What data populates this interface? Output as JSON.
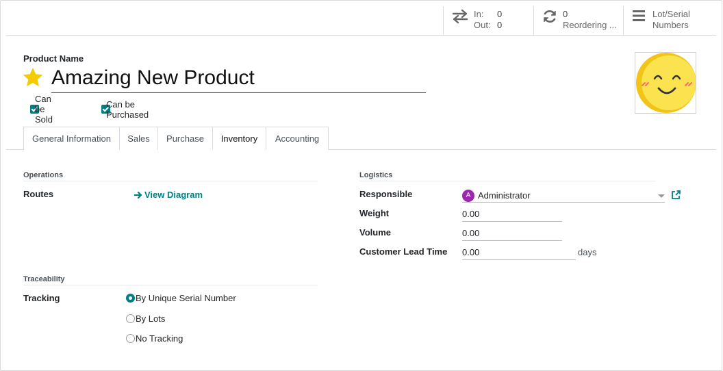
{
  "stats": {
    "in_label": "In:",
    "in_value": "0",
    "out_label": "Out:",
    "out_value": "0",
    "reorder_value": "0",
    "reorder_label": "Reordering ...",
    "lots_label_1": "Lot/Serial",
    "lots_label_2": "Numbers"
  },
  "product": {
    "name_label": "Product Name",
    "name": "Amazing New Product",
    "can_be_sold": "Can be Sold",
    "can_be_purchased": "Can be Purchased"
  },
  "tabs": [
    {
      "label": "General Information"
    },
    {
      "label": "Sales"
    },
    {
      "label": "Purchase"
    },
    {
      "label": "Inventory"
    },
    {
      "label": "Accounting"
    }
  ],
  "operations": {
    "title": "Operations",
    "routes_label": "Routes",
    "view_diagram": "View Diagram"
  },
  "traceability": {
    "title": "Traceability",
    "tracking_label": "Tracking",
    "options": [
      "By Unique Serial Number",
      "By Lots",
      "No Tracking"
    ],
    "selected": "By Unique Serial Number"
  },
  "logistics": {
    "title": "Logistics",
    "responsible_label": "Responsible",
    "responsible_initial": "A",
    "responsible_value": "Administrator",
    "weight_label": "Weight",
    "weight_value": "0.00",
    "volume_label": "Volume",
    "volume_value": "0.00",
    "lead_time_label": "Customer Lead Time",
    "lead_time_value": "0.00",
    "lead_time_unit": "days"
  },
  "colors": {
    "accent": "#017e84",
    "star": "#f3cc00",
    "avatar": "#9c27b0"
  }
}
